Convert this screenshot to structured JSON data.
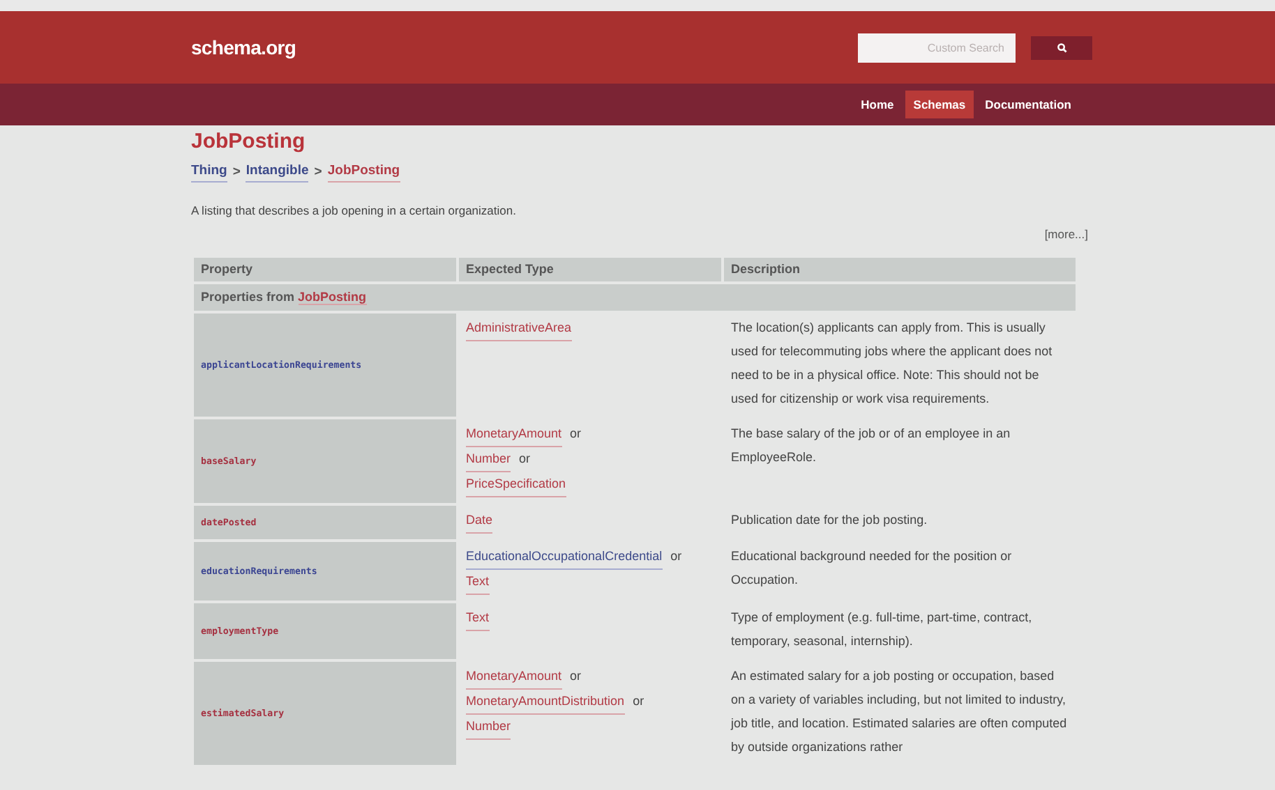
{
  "header": {
    "logo": "schema.org",
    "search": {
      "placeholder": "Custom Search"
    }
  },
  "nav": [
    {
      "label": "Home",
      "selected": false
    },
    {
      "label": "Schemas",
      "selected": true
    },
    {
      "label": "Documentation",
      "selected": false
    }
  ],
  "title": "JobPosting",
  "breadcrumb": [
    {
      "label": "Thing",
      "visited": false
    },
    {
      "label": "Intangible",
      "visited": false
    },
    {
      "label": "JobPosting",
      "visited": true
    }
  ],
  "breadcrumb_separator": ">",
  "description": "A listing that describes a job opening in a certain organization.",
  "more_link": "[more...]",
  "table": {
    "columns": [
      "Property",
      "Expected Type",
      "Description"
    ],
    "group": {
      "prefix": "Properties from",
      "link": "JobPosting"
    },
    "rows": [
      {
        "property": "applicantLocationRequirements",
        "visited": false,
        "types": [
          {
            "label": "AdministrativeArea",
            "visited": true
          }
        ],
        "description": "The location(s) applicants can apply from. This is usually used for telecommuting jobs where the applicant does not need to be in a physical office. Note: This should not be used for citizenship or work visa requirements."
      },
      {
        "property": "baseSalary",
        "visited": true,
        "types": [
          {
            "label": "MonetaryAmount",
            "visited": true,
            "separator": "or"
          },
          {
            "label": "Number",
            "visited": true,
            "separator": "or"
          },
          {
            "label": "PriceSpecification",
            "visited": true
          }
        ],
        "description": "The base salary of the job or of an employee in an EmployeeRole."
      },
      {
        "property": "datePosted",
        "visited": true,
        "types": [
          {
            "label": "Date",
            "visited": true
          }
        ],
        "description": "Publication date for the job posting."
      },
      {
        "property": "educationRequirements",
        "visited": false,
        "types": [
          {
            "label": "EducationalOccupationalCredential",
            "visited": false,
            "separator": "or"
          },
          {
            "label": "Text",
            "visited": true
          }
        ],
        "description": "Educational background needed for the position or Occupation."
      },
      {
        "property": "employmentType",
        "visited": true,
        "types": [
          {
            "label": "Text",
            "visited": true
          }
        ],
        "description": "Type of employment (e.g. full-time, part-time, contract, temporary, seasonal, internship)."
      },
      {
        "property": "estimatedSalary",
        "visited": true,
        "types": [
          {
            "label": "MonetaryAmount",
            "visited": true,
            "separator": "or"
          },
          {
            "label": "MonetaryAmountDistribution",
            "visited": true,
            "separator": "or"
          },
          {
            "label": "Number",
            "visited": true
          }
        ],
        "description": "An estimated salary for a job posting or occupation, based on a variety of variables including, but not limited to industry, job title, and location. Estimated salaries are often computed by outside organizations rather"
      }
    ]
  }
}
